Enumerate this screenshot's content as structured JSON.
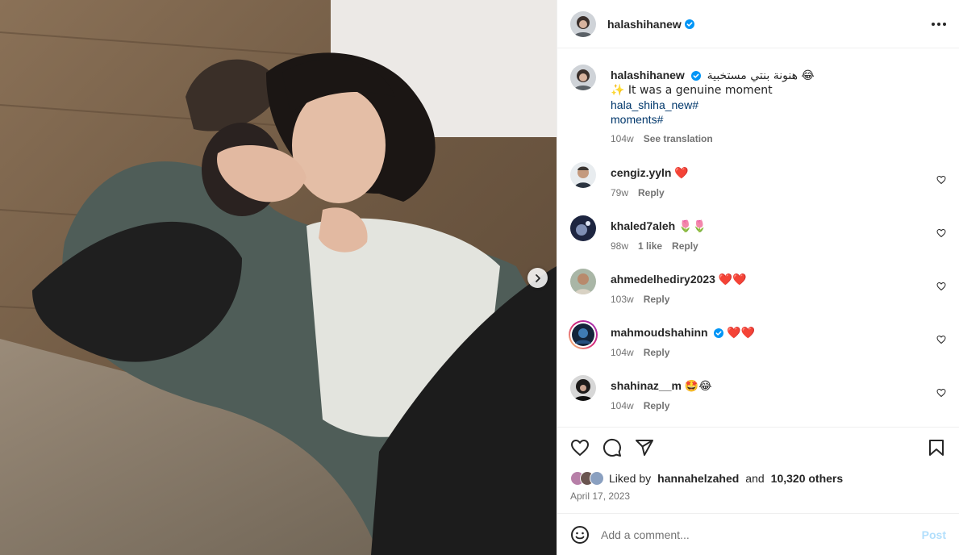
{
  "header": {
    "username": "halashihanew",
    "more_icon": "more-horizontal-icon"
  },
  "caption": {
    "username": "halashihanew",
    "text_line1": "هنونة بنتي مستخبية 😂",
    "text_line2": "✨ It was a genuine moment",
    "hashtags": [
      "hala_shiha_new#",
      "moments#"
    ],
    "time": "104w",
    "see_translation": "See translation"
  },
  "comments": [
    {
      "username": "cengiz.yyln",
      "text": "❤️",
      "time": "79w",
      "likes": "",
      "reply": "Reply",
      "verified": false
    },
    {
      "username": "khaled7aleh",
      "text": "🌷🌷",
      "time": "98w",
      "likes": "1 like",
      "reply": "Reply",
      "verified": false
    },
    {
      "username": "ahmedelhediry2023",
      "text": "❤️❤️",
      "time": "103w",
      "likes": "",
      "reply": "Reply",
      "verified": false
    },
    {
      "username": "mahmoudshahinn",
      "text": "❤️❤️",
      "time": "104w",
      "likes": "",
      "reply": "Reply",
      "verified": true
    },
    {
      "username": "shahinaz__m",
      "text": "🤩😂",
      "time": "104w",
      "likes": "",
      "reply": "Reply",
      "verified": false
    }
  ],
  "actions": {
    "icons": [
      "heart-icon",
      "comment-icon",
      "share-icon",
      "bookmark-icon"
    ]
  },
  "likes": {
    "prefix": "Liked by",
    "user": "hannahelzahed",
    "and": "and",
    "others": "10,320 others"
  },
  "date": "April 17, 2023",
  "add_comment": {
    "placeholder": "Add a comment...",
    "post_label": "Post"
  },
  "colors": {
    "verified": "#0095f6",
    "heart_red": "#ff3040",
    "link": "#00376b",
    "post_disabled": "#b2dffc"
  }
}
